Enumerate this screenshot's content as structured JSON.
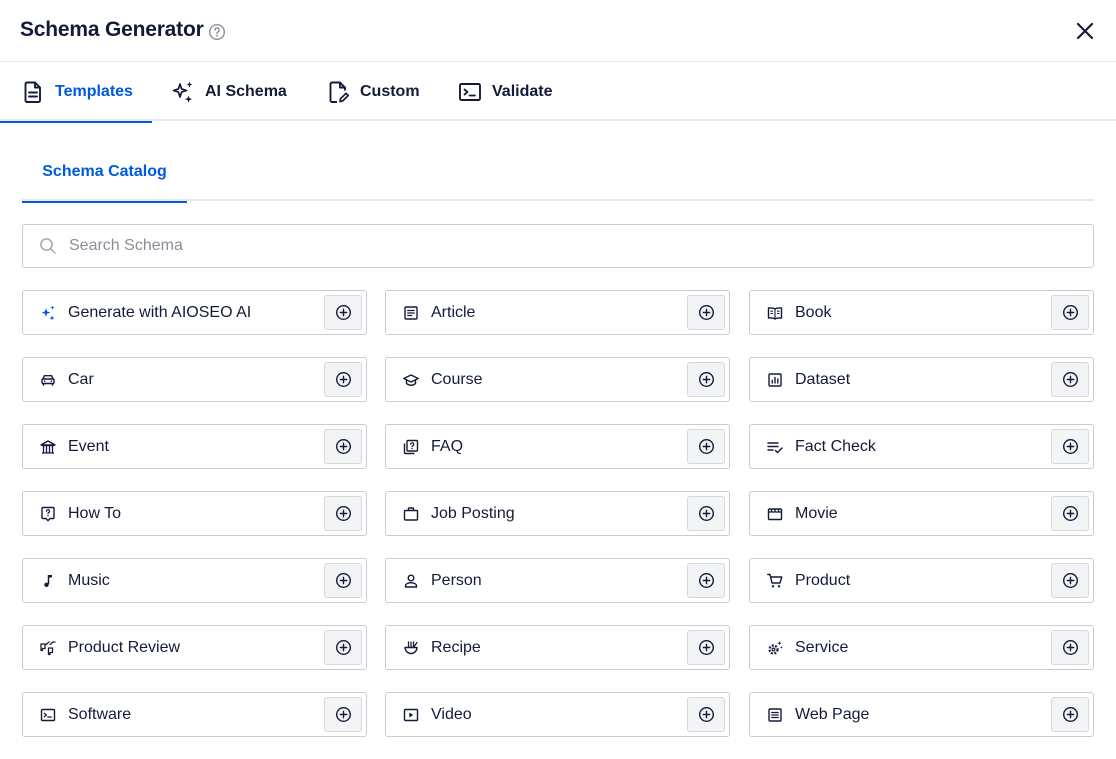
{
  "header": {
    "title": "Schema Generator"
  },
  "tabs": [
    {
      "label": "Templates",
      "icon": "document-icon",
      "active": true
    },
    {
      "label": "AI Schema",
      "icon": "sparkles-icon",
      "active": false
    },
    {
      "label": "Custom",
      "icon": "edit-document-icon",
      "active": false
    },
    {
      "label": "Validate",
      "icon": "terminal-icon",
      "active": false
    }
  ],
  "subtabs": [
    {
      "label": "Schema Catalog",
      "active": true
    }
  ],
  "search": {
    "placeholder": "Search Schema",
    "value": ""
  },
  "colors": {
    "accent": "#005ae0",
    "text": "#141b38",
    "border": "#c9ccd4"
  },
  "schemas": [
    {
      "label": "Generate with AIOSEO AI",
      "icon": "sparkles-icon"
    },
    {
      "label": "Article",
      "icon": "article-icon"
    },
    {
      "label": "Book",
      "icon": "book-icon"
    },
    {
      "label": "Car",
      "icon": "car-icon"
    },
    {
      "label": "Course",
      "icon": "graduation-cap-icon"
    },
    {
      "label": "Dataset",
      "icon": "dataset-icon"
    },
    {
      "label": "Event",
      "icon": "event-venue-icon"
    },
    {
      "label": "FAQ",
      "icon": "faq-icon"
    },
    {
      "label": "Fact Check",
      "icon": "fact-check-icon"
    },
    {
      "label": "How To",
      "icon": "how-to-icon"
    },
    {
      "label": "Job Posting",
      "icon": "briefcase-icon"
    },
    {
      "label": "Movie",
      "icon": "movie-icon"
    },
    {
      "label": "Music",
      "icon": "music-note-icon"
    },
    {
      "label": "Person",
      "icon": "person-icon"
    },
    {
      "label": "Product",
      "icon": "cart-icon"
    },
    {
      "label": "Product Review",
      "icon": "review-icon"
    },
    {
      "label": "Recipe",
      "icon": "recipe-icon"
    },
    {
      "label": "Service",
      "icon": "service-icon"
    },
    {
      "label": "Software",
      "icon": "software-icon"
    },
    {
      "label": "Video",
      "icon": "video-icon"
    },
    {
      "label": "Web Page",
      "icon": "web-page-icon"
    }
  ]
}
